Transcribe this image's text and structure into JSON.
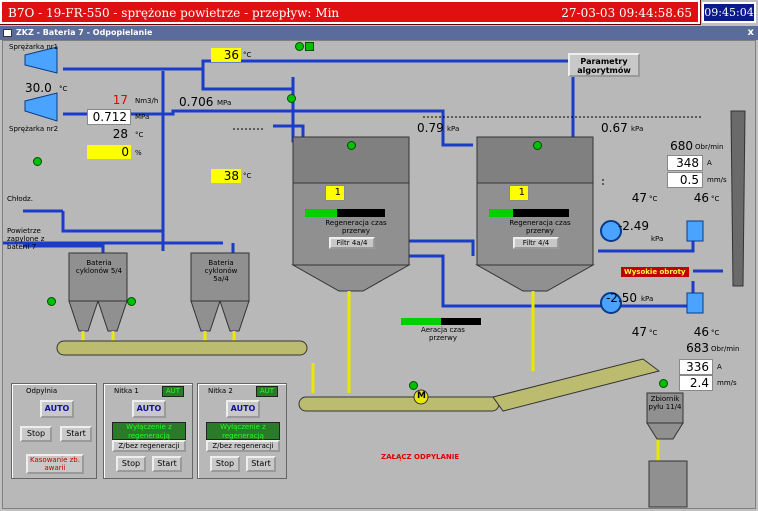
{
  "alarm": {
    "text": "B7O - 19-FR-550 - sprężone powietrze - przepływ: Min",
    "datetime": "27-03-03  09:44:58.65"
  },
  "clock": "09:45:04",
  "window": {
    "title": "ZKZ - Bateria 7 - Odpopielanie",
    "close": "x"
  },
  "compressors": {
    "label1": "Sprężarka nr1",
    "label2": "Sprężarka nr2",
    "pressure": "30.0",
    "pressure_unit": "°C"
  },
  "flow": {
    "value": "17",
    "unit": "Nm3/h"
  },
  "pressure_main": {
    "value": "0.712",
    "unit": "MPa"
  },
  "temp_main": {
    "value": "28",
    "unit": "°C"
  },
  "pct": {
    "value": "0",
    "unit": "%"
  },
  "pipe_pressure": {
    "value": "0.706",
    "unit": "MPa"
  },
  "temp_top": {
    "value": "36",
    "unit": "°C"
  },
  "temp_mid": {
    "value": "38",
    "unit": "°C"
  },
  "chlodz": "Chłodz.",
  "air_note": "Powietrze zapylone z baterii 7",
  "param_button": "Parametry algorytmów",
  "filter1": {
    "pressure": "0.79",
    "unit": "kPa",
    "counter": "1",
    "label": "Regeneracja czas przerwy",
    "filter": "Filtr 4a/4"
  },
  "filter2": {
    "pressure": "0.67",
    "unit": "kPa",
    "counter": "1",
    "label": "Regeneracja czas przerwy",
    "filter": "Filtr 4/4"
  },
  "cyclone1": "Bateria cyklonów 5/4",
  "cyclone2": "Bateria cyklonów 5a/4",
  "aeration": "Aeracja czas przerwy",
  "fan_top": {
    "rpm": "680",
    "rpm_unit": "Obr/min",
    "amp": "348",
    "amp_unit": "A",
    "vib": "0.5",
    "vib_unit": "mm/s",
    "temp_bearing": "46",
    "temp_unit": "°C",
    "temp_in": "47",
    "dp": "-2.49",
    "dp_unit": "kPa"
  },
  "fan_bottom": {
    "rpm": "683",
    "rpm_unit": "Obr/min",
    "amp": "336",
    "amp_unit": "A",
    "vib": "2.4",
    "vib_unit": "mm/s",
    "temp_bearing": "46",
    "temp_unit": "°C",
    "temp_in": "47",
    "dp": "-2.50",
    "dp_unit": "kPa"
  },
  "alarm_high_speed": "Wysokie obroty",
  "tank": "Zbiornik pyłu 11/4",
  "start_dedust": "ZAŁĄCZ ODPYLANIE",
  "motor_label": "M",
  "panel_dedust": {
    "title": "Odpylnia",
    "auto": "AUTO",
    "stop": "Stop",
    "start": "Start",
    "reset": "Kasowanie zb. awarii"
  },
  "panel_nitka1": {
    "title": "Nitka 1",
    "mode": "AUT",
    "auto": "AUTO",
    "status": "Wyłączenie z regeneracją",
    "toggle": "Z/bez regeneracji",
    "stop": "Stop",
    "start": "Start"
  },
  "panel_nitka2": {
    "title": "Nitka 2",
    "mode": "AUT",
    "auto": "AUTO",
    "status": "Wyłączenie z regeneracją",
    "toggle": "Z/bez regeneracji",
    "stop": "Stop",
    "start": "Start"
  }
}
